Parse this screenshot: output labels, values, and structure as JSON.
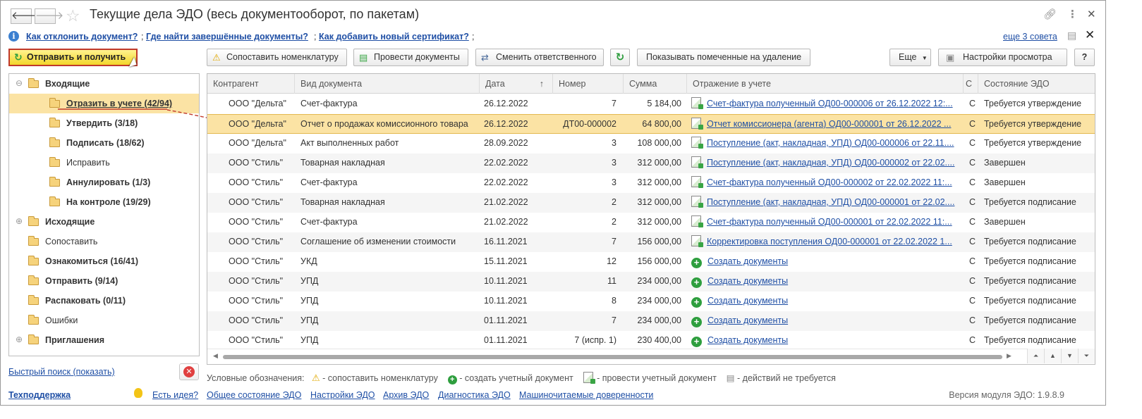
{
  "window": {
    "title": "Текущие дела ЭДО (весь документооборот, по пакетам)",
    "back_label": "🡐",
    "forward_label": "🡒"
  },
  "hints": {
    "links": [
      "Как отклонить документ?",
      "Где найти завершённые документы?",
      "Как добавить новый сертификат?"
    ],
    "separator": ";",
    "more": "еще 3 совета"
  },
  "toolbar": {
    "send_receive": "Отправить и получить",
    "match_nomenclature": "Сопоставить номенклатуру",
    "post_documents": "Провести документы",
    "change_responsible": "Сменить ответственного",
    "show_marked_deleted": "Показывать помеченные на удаление",
    "more": "Еще",
    "view_settings": "Настройки просмотра",
    "help": "?"
  },
  "tree": [
    {
      "label": "Входящие",
      "bold": true,
      "level": 0,
      "toggle": "⊖"
    },
    {
      "label": "Отразить в учете (42/94)",
      "bold": true,
      "level": 1,
      "selected": true
    },
    {
      "label": "Утвердить (3/18)",
      "bold": true,
      "level": 1
    },
    {
      "label": "Подписать (18/62)",
      "bold": true,
      "level": 1
    },
    {
      "label": "Исправить",
      "bold": false,
      "level": 1
    },
    {
      "label": "Аннулировать (1/3)",
      "bold": true,
      "level": 1
    },
    {
      "label": "На контроле (19/29)",
      "bold": true,
      "level": 1
    },
    {
      "label": "Исходящие",
      "bold": true,
      "level": 0,
      "toggle": "⊕"
    },
    {
      "label": "Сопоставить",
      "bold": false,
      "level": 0
    },
    {
      "label": "Ознакомиться (16/41)",
      "bold": true,
      "level": 0
    },
    {
      "label": "Отправить (9/14)",
      "bold": true,
      "level": 0
    },
    {
      "label": "Распаковать (0/11)",
      "bold": true,
      "level": 0
    },
    {
      "label": "Ошибки",
      "bold": false,
      "level": 0
    },
    {
      "label": "Приглашения",
      "bold": true,
      "level": 0,
      "toggle": "⊕"
    }
  ],
  "quick_search": "Быстрый поиск (показать)",
  "grid": {
    "columns": [
      "Контрагент",
      "Вид документа",
      "Дата",
      "Номер",
      "Сумма",
      "Отражение в учете",
      "С",
      "Состояние ЭДО"
    ],
    "sort_indicator": "↑",
    "rows": [
      {
        "counterparty": "ООО \"Дельта\"",
        "doc_type": "Счет-фактура",
        "date": "26.12.2022",
        "number": "7",
        "sum": "5 184,00",
        "icon": "doc",
        "reflection": "Счет-фактура полученный ОД00-000006 от 26.12.2022 12:...",
        "c": "С",
        "state": "Требуется утверждение"
      },
      {
        "counterparty": "ООО \"Дельта\"",
        "doc_type": "Отчет о продажах комиссионного товара",
        "date": "26.12.2022",
        "number": "ДТ00-000002",
        "sum": "64 800,00",
        "icon": "doc",
        "reflection": "Отчет комиссионера (агента) ОД00-000001 от 26.12.2022 ...",
        "c": "С",
        "state": "Требуется утверждение",
        "selected": true
      },
      {
        "counterparty": "ООО \"Дельта\"",
        "doc_type": "Акт выполненных работ",
        "date": "28.09.2022",
        "number": "3",
        "sum": "108 000,00",
        "icon": "doc",
        "reflection": "Поступление (акт, накладная, УПД) ОД00-000006 от 22.11....",
        "c": "С",
        "state": "Требуется утверждение"
      },
      {
        "counterparty": "ООО \"Стиль\"",
        "doc_type": "Товарная накладная",
        "date": "22.02.2022",
        "number": "3",
        "sum": "312 000,00",
        "icon": "doc",
        "reflection": "Поступление (акт, накладная, УПД) ОД00-000002 от 22.02....",
        "c": "С",
        "state": "Завершен"
      },
      {
        "counterparty": "ООО \"Стиль\"",
        "doc_type": "Счет-фактура",
        "date": "22.02.2022",
        "number": "3",
        "sum": "312 000,00",
        "icon": "doc",
        "reflection": "Счет-фактура полученный ОД00-000002 от 22.02.2022 11:...",
        "c": "С",
        "state": "Завершен"
      },
      {
        "counterparty": "ООО \"Стиль\"",
        "doc_type": "Товарная накладная",
        "date": "21.02.2022",
        "number": "2",
        "sum": "312 000,00",
        "icon": "doc",
        "reflection": "Поступление (акт, накладная, УПД) ОД00-000001 от 22.02....",
        "c": "С",
        "state": "Требуется подписание"
      },
      {
        "counterparty": "ООО \"Стиль\"",
        "doc_type": "Счет-фактура",
        "date": "21.02.2022",
        "number": "2",
        "sum": "312 000,00",
        "icon": "doc",
        "reflection": "Счет-фактура полученный ОД00-000001 от 22.02.2022 11:...",
        "c": "С",
        "state": "Завершен"
      },
      {
        "counterparty": "ООО \"Стиль\"",
        "doc_type": "Соглашение об изменении стоимости",
        "date": "16.11.2021",
        "number": "7",
        "sum": "156 000,00",
        "icon": "doc",
        "reflection": "Корректировка поступления ОД00-000001 от 22.02.2022 1...",
        "c": "С",
        "state": "Требуется подписание"
      },
      {
        "counterparty": "ООО \"Стиль\"",
        "doc_type": "УКД",
        "date": "15.11.2021",
        "number": "12",
        "sum": "156 000,00",
        "icon": "add",
        "reflection": "Создать документы",
        "c": "С",
        "state": "Требуется подписание"
      },
      {
        "counterparty": "ООО \"Стиль\"",
        "doc_type": "УПД",
        "date": "10.11.2021",
        "number": "11",
        "sum": "234 000,00",
        "icon": "add",
        "reflection": "Создать документы",
        "c": "С",
        "state": "Требуется подписание"
      },
      {
        "counterparty": "ООО \"Стиль\"",
        "doc_type": "УПД",
        "date": "10.11.2021",
        "number": "8",
        "sum": "234 000,00",
        "icon": "add",
        "reflection": "Создать документы",
        "c": "С",
        "state": "Требуется подписание"
      },
      {
        "counterparty": "ООО \"Стиль\"",
        "doc_type": "УПД",
        "date": "01.11.2021",
        "number": "7",
        "sum": "234 000,00",
        "icon": "add",
        "reflection": "Создать документы",
        "c": "С",
        "state": "Требуется подписание"
      },
      {
        "counterparty": "ООО \"Стиль\"",
        "doc_type": "УПД",
        "date": "01.11.2021",
        "number": "7 (испр. 1)",
        "sum": "230 400,00",
        "icon": "add",
        "reflection": "Создать документы",
        "c": "С",
        "state": "Требуется подписание"
      }
    ]
  },
  "legend": {
    "title": "Условные обозначения:",
    "match": "- сопоставить номенклатуру",
    "create": "- создать учетный документ",
    "post": "- провести учетный документ",
    "none": "- действий не требуется"
  },
  "footer": {
    "support": "Техподдержка",
    "links": [
      "Есть идея?",
      "Общее состояние ЭДО",
      "Настройки ЭДО",
      "Архив ЭДО",
      "Диагностика ЭДО",
      "Машиночитаемые доверенности"
    ],
    "version": "Версия модуля ЭДО: 1.9.8.9"
  },
  "colors": {
    "link": "#1f4fa5",
    "selection": "#fbe3a4",
    "send_button": "#f3d62a",
    "send_button_border": "#c0392b",
    "arrow": "#c0392b"
  }
}
